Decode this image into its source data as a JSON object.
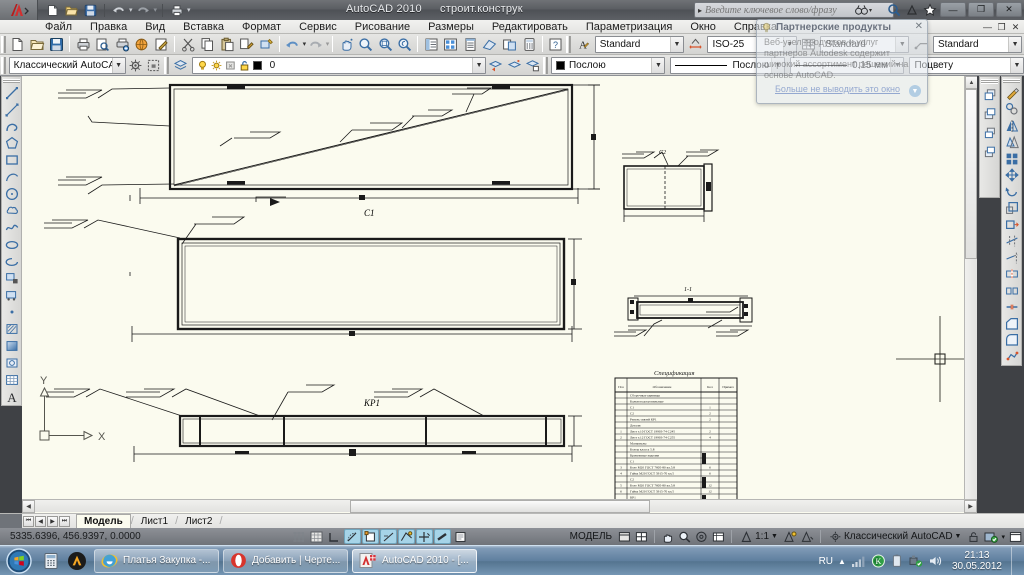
{
  "titlebar": {
    "app_title": "AutoCAD 2010",
    "document_title": "строит.конструк",
    "quick_access": [
      {
        "name": "new-file-button",
        "icon": "new-file-icon"
      },
      {
        "name": "open-file-button",
        "icon": "open-folder-icon"
      },
      {
        "name": "save-button",
        "icon": "save-disk-icon"
      },
      {
        "name": "undo-button",
        "icon": "undo-arrow-icon"
      },
      {
        "name": "redo-button",
        "icon": "redo-arrow-icon"
      },
      {
        "name": "plot-button",
        "icon": "printer-icon"
      }
    ],
    "search": {
      "placeholder": "Введите ключевое слово/фразу",
      "value": ""
    },
    "info_icons": [
      "binoculars-icon",
      "search-magnifier-icon",
      "signin-icon",
      "favorites-star-icon",
      "help-question-icon"
    ],
    "window_controls": {
      "minimize": "—",
      "maximize": "❐",
      "close": "✕"
    }
  },
  "menubar": {
    "items": [
      {
        "label": "Файл",
        "name": "menu-file"
      },
      {
        "label": "Правка",
        "name": "menu-edit"
      },
      {
        "label": "Вид",
        "name": "menu-view"
      },
      {
        "label": "Вставка",
        "name": "menu-insert"
      },
      {
        "label": "Формат",
        "name": "menu-format"
      },
      {
        "label": "Сервис",
        "name": "menu-tools"
      },
      {
        "label": "Рисование",
        "name": "menu-draw"
      },
      {
        "label": "Размеры",
        "name": "menu-dimensions"
      },
      {
        "label": "Редактировать",
        "name": "menu-modify"
      },
      {
        "label": "Параметризация",
        "name": "menu-parametric"
      },
      {
        "label": "Окно",
        "name": "menu-window"
      },
      {
        "label": "Справка",
        "name": "menu-help"
      }
    ]
  },
  "toolbars": {
    "workspace_combo": {
      "value": "Классический AutoCAD",
      "name": "workspace-combo"
    },
    "layer_combo": {
      "value": "0",
      "name": "layer-combo"
    },
    "text_style_combo": {
      "value": "Standard",
      "name": "text-style-combo"
    },
    "dim_style_combo": {
      "value": "ISO-25",
      "name": "dimension-style-combo"
    },
    "table_style_combo": {
      "value": "Standard",
      "name": "table-style-combo"
    },
    "mleader_style_combo": {
      "value": "Standard",
      "name": "multileader-style-combo"
    },
    "color_combo": {
      "value": "Послою",
      "name": "color-combo"
    },
    "linetype_combo": {
      "value": "Послою",
      "name": "linetype-combo"
    },
    "lineweight_combo": {
      "value": "0.15 мм",
      "name": "lineweight-combo"
    },
    "plotstyle_combo": {
      "value": "Поцвету",
      "name": "plot-style-combo"
    }
  },
  "balloon": {
    "title": "Партнерские продукты",
    "body": "Веб-узел продуктов и услуг партнеров Autodesk содержит широкий ассортимент решений на основе AutoCAD.",
    "link": "Больше не выводить это окно",
    "close": "✕"
  },
  "drawing": {
    "view_labels": [
      {
        "text": "С1",
        "name": "view-label-c1-top"
      },
      {
        "text": "С2",
        "name": "view-label-c2"
      },
      {
        "text": "КР1",
        "name": "view-label-kr1"
      },
      {
        "text": "1-1",
        "name": "view-label-section-1-1"
      }
    ],
    "ucs": {
      "x": "X",
      "y": "Y"
    },
    "spec_title": "Спецификация",
    "spec_headers": [
      "Поз",
      "Обозначение",
      "Кол",
      "Примеч"
    ],
    "spec_rows": [
      {
        "pos": "",
        "name": "Сборочные единицы",
        "qty": "",
        "note": ""
      },
      {
        "pos": "",
        "name": "Балки подстропильные",
        "qty": "",
        "note": ""
      },
      {
        "pos": "",
        "name": "С1",
        "qty": "1",
        "note": ""
      },
      {
        "pos": "",
        "name": "С2",
        "qty": "2",
        "note": ""
      },
      {
        "pos": "",
        "name": "Ригель связей КР1",
        "qty": "2",
        "note": ""
      },
      {
        "pos": "",
        "name": "Детали",
        "qty": "",
        "note": ""
      },
      {
        "pos": "1",
        "name": "Лист т.10 ГОСТ 19903-74 С245",
        "qty": "2",
        "note": ""
      },
      {
        "pos": "2",
        "name": "Лист т.12 ГОСТ 19903-74 С255",
        "qty": "4",
        "note": ""
      },
      {
        "pos": "",
        "name": "Материалы",
        "qty": "",
        "note": ""
      },
      {
        "pos": "",
        "name": "Болты класса 5.8",
        "qty": "",
        "note": ""
      },
      {
        "pos": "",
        "name": "Крепежные изделия",
        "qty": "",
        "note": ""
      },
      {
        "pos": "",
        "name": "С1",
        "qty": "",
        "note": ""
      },
      {
        "pos": "3",
        "name": "Болт М20 ГОСТ 7805-80 кл.5.8",
        "qty": "6",
        "note": ""
      },
      {
        "pos": "4",
        "name": "Гайка М20 ГОСТ 5915-70 кл.5",
        "qty": "6",
        "note": ""
      },
      {
        "pos": "",
        "name": "С2",
        "qty": "",
        "note": ""
      },
      {
        "pos": "5",
        "name": "Болт М20 ГОСТ 7805-80 кл.5.8",
        "qty": "12",
        "note": ""
      },
      {
        "pos": "6",
        "name": "Гайка М20 ГОСТ 5915-70 кл.5",
        "qty": "12",
        "note": ""
      },
      {
        "pos": "",
        "name": "КР1",
        "qty": "",
        "note": ""
      },
      {
        "pos": "7",
        "name": "Болт М20 ГОСТ 7805-80 кл.5.8",
        "qty": "8",
        "note": ""
      },
      {
        "pos": "8",
        "name": "Гайка М20 ГОСТ 5915-70 кл.5",
        "qty": "8",
        "note": ""
      }
    ]
  },
  "layout_tabs": {
    "nav": [
      "⏮",
      "◀",
      "▶",
      "⏭"
    ],
    "tabs": [
      {
        "label": "Модель",
        "name": "layout-tab-model",
        "active": true
      },
      {
        "label": "Лист1",
        "name": "layout-tab-sheet1",
        "active": false
      },
      {
        "label": "Лист2",
        "name": "layout-tab-sheet2",
        "active": false
      }
    ]
  },
  "statusbar": {
    "coordinates": "5335.6396, 456.9397, 0.0000",
    "toggles": [
      {
        "name": "snap-toggle",
        "icon": "snap-grid-icon",
        "on": false
      },
      {
        "name": "grid-toggle",
        "icon": "grid-icon",
        "on": false
      },
      {
        "name": "ortho-toggle",
        "icon": "ortho-icon",
        "on": false
      },
      {
        "name": "polar-toggle",
        "icon": "polar-tracking-icon",
        "on": true
      },
      {
        "name": "osnap-toggle",
        "icon": "object-snap-icon",
        "on": true
      },
      {
        "name": "otrack-toggle",
        "icon": "object-snap-tracking-icon",
        "on": true
      },
      {
        "name": "ducs-toggle",
        "icon": "dynamic-ucs-icon",
        "on": true
      },
      {
        "name": "dyn-toggle",
        "icon": "dynamic-input-icon",
        "on": true
      },
      {
        "name": "lineweight-toggle",
        "icon": "show-lineweight-icon",
        "on": true
      },
      {
        "name": "qp-toggle",
        "icon": "quick-properties-icon",
        "on": false
      }
    ],
    "space_label": "МОДЕЛЬ",
    "annotation_scale": "1:1",
    "workspace_label": "Классический AutoCAD"
  },
  "taskbar": {
    "start": "start-orb",
    "quicklaunch": [
      "calculator-icon",
      "autocad-launcher-icon"
    ],
    "items": [
      {
        "label": "Платья Закупка -...",
        "name": "taskbar-item-ie",
        "icon": "internet-explorer-icon"
      },
      {
        "label": "Добавить | Черте...",
        "name": "taskbar-item-opera",
        "icon": "opera-icon"
      },
      {
        "label": "AutoCAD 2010 - [...",
        "name": "taskbar-item-autocad",
        "icon": "autocad-icon",
        "active": true
      }
    ],
    "tray": {
      "language": "RU",
      "icons": [
        "show-hidden-icons",
        "network-signal-icon",
        "antivirus-icon",
        "battery-icon",
        "usb-safely-remove-icon",
        "volume-icon"
      ],
      "time": "21:13",
      "date": "30.05.2012"
    }
  },
  "colors": {
    "canvas": "#fbfbef",
    "chrome": "#d4d4d2",
    "titlebar": "#5b5e63",
    "taskbar": "#5e7e9e",
    "status_on": "#a6d4e8"
  }
}
